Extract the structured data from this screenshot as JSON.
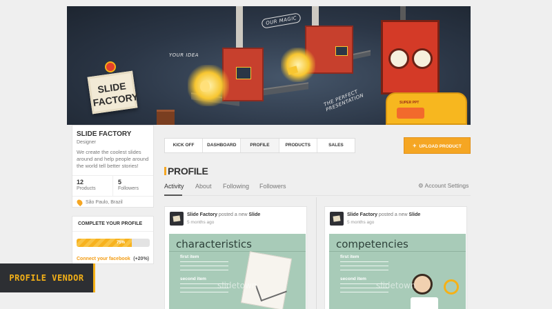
{
  "banner": {
    "logo_line1": "SLIDE",
    "logo_line2": "FACTORY",
    "label_idea": "YOUR IDEA",
    "label_magic": "OUR MAGIC",
    "label_presentation_1": "THE PERFECT",
    "label_presentation_2": "PRESENTATION",
    "robot_badge": "SUPER PPT"
  },
  "profile": {
    "name": "SLIDE FACTORY",
    "role": "Designer",
    "bio": "We create the coolest slides around and help people around the world tell better stories!",
    "products_count": "12",
    "products_label": "Products",
    "followers_count": "5",
    "followers_label": "Followers",
    "location": "São Paulo, Brazil"
  },
  "complete_profile": {
    "title": "COMPLETE YOUR PROFILE",
    "progress_text": "75%",
    "progress_value": 0.75,
    "link_text": "Connect your facebook",
    "bonus": "(+20%)"
  },
  "vendor_label": "PROFILE VENDOR",
  "nav": [
    "KICK OFF",
    "DASHBOARD",
    "PROFILE",
    "PRODUCTS",
    "SALES"
  ],
  "upload_button": "UPLOAD PRODUCT",
  "page_title": "PROFILE",
  "subtabs": [
    "Activity",
    "About",
    "Following",
    "Followers"
  ],
  "account_settings": "Account Settings",
  "posts": [
    {
      "author": "Slide Factory",
      "action": "posted a new",
      "object": "Slide",
      "time": "5 months ago",
      "slide_title": "characteristics",
      "first_item": "first item",
      "second_item": "second item",
      "watermark": "slidetown"
    },
    {
      "author": "Slide Factory",
      "action": "posted a new",
      "object": "Slide",
      "time": "5 months ago",
      "slide_title": "competencies",
      "first_item": "first item",
      "second_item": "second item",
      "watermark": "slidetown"
    }
  ],
  "colors": {
    "accent": "#f5a623",
    "banner_dark": "#2b3646",
    "slide_bg": "#a8cbb8"
  }
}
